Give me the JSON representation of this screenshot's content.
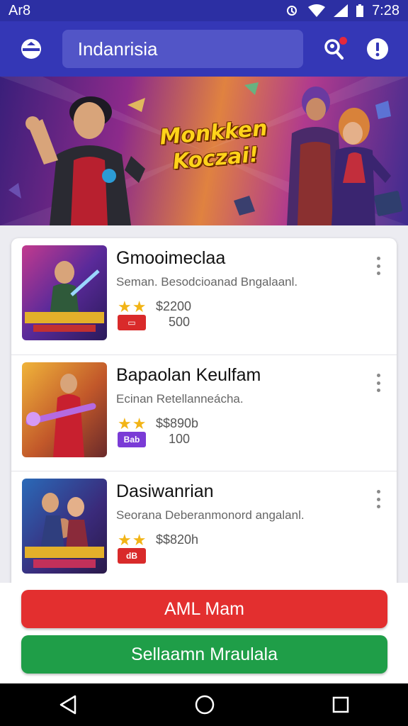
{
  "status_bar": {
    "left_text": "Ar8",
    "time": "7:28"
  },
  "app_bar": {
    "search_text": "Indanrisia"
  },
  "banner": {
    "title": "Monkken Koczai!"
  },
  "list": [
    {
      "title": "Gmooimeclaa",
      "subtitle": "Seman. Besodcioanad Bngalaanl.",
      "stars": "★★",
      "price": "$2200",
      "tag": "▭",
      "count": "500",
      "tag_color": "#d92a2a"
    },
    {
      "title": "Bapaolan Keulfam",
      "subtitle": "Ecinan Retellanneácha.",
      "stars": "★★",
      "price": "$$890b",
      "tag": "Bab",
      "count": "100",
      "tag_color": "#7a3bd6"
    },
    {
      "title": "Dasiwanrian",
      "subtitle": "Seorana Deberanmonord angalanl.",
      "stars": "★★",
      "price": "$$820h",
      "tag": "dB",
      "count": "",
      "tag_color": "#d92a2a"
    }
  ],
  "buttons": {
    "primary": "AML Mam",
    "secondary": "Sellaamn Mraulala"
  },
  "colors": {
    "status_bar": "#2c2fa3",
    "app_bar": "#3437b6",
    "search_box": "#5255c7",
    "red_button": "#e32f2f",
    "green_button": "#1f9e48",
    "star": "#f2b416"
  },
  "icons": {
    "app_logo": "logo-icon",
    "search": "search-person-icon",
    "info": "info-icon",
    "more": "more-vertical-icon",
    "nav_back": "back-triangle-icon",
    "nav_home": "home-circle-icon",
    "nav_recents": "recents-square-icon"
  }
}
